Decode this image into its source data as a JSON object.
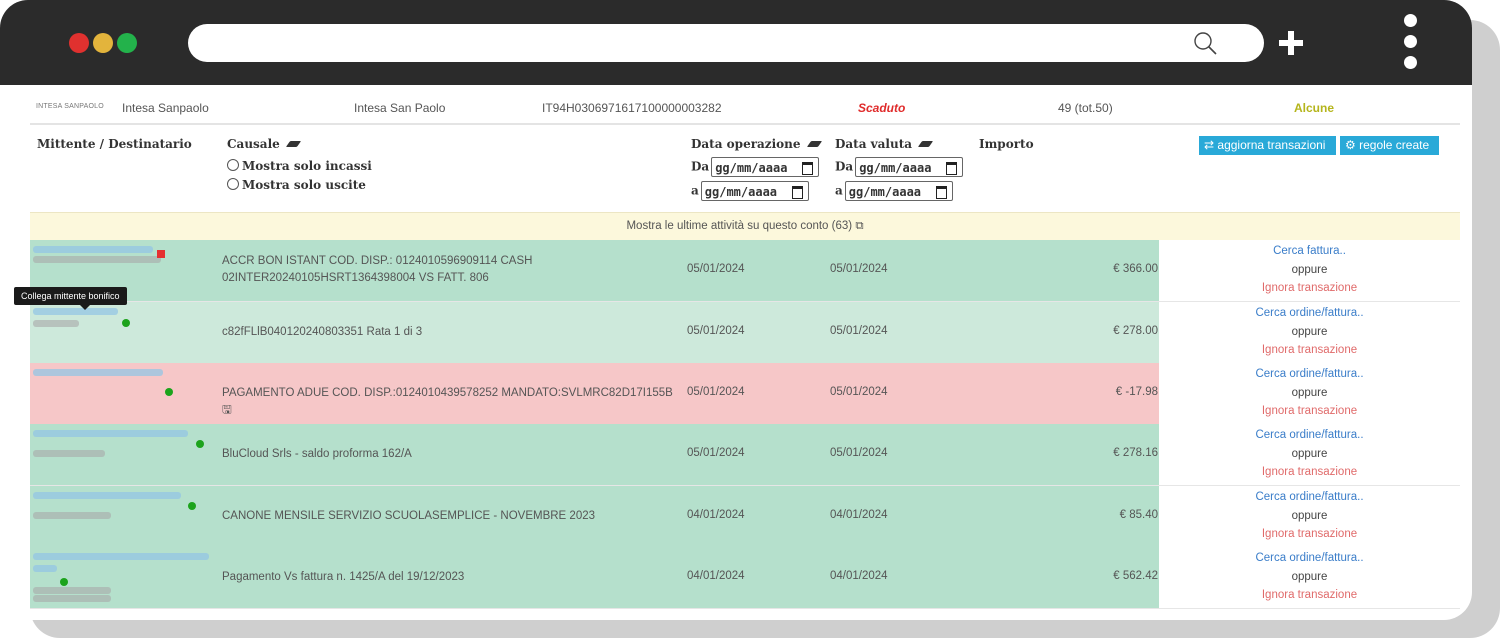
{
  "browser": {
    "dots": [
      "#e0312f",
      "#e3b43c",
      "#23b24b"
    ],
    "url": "",
    "icons": [
      "search-icon",
      "plus-icon",
      "more-vertical-icon"
    ]
  },
  "bank": {
    "logo_text": "INTESA SANPAOLO",
    "name": "Intesa Sanpaolo",
    "bank_label": "Intesa San Paolo",
    "iban": "IT94H0306971617100000003282",
    "status": "Scaduto",
    "count": "49 (tot.50)",
    "rules": "Alcune"
  },
  "filters": {
    "col_mittente": "Mittente / Destinatario",
    "col_causale": "Causale",
    "radio_incassi": "Mostra solo incassi",
    "radio_uscite": "Mostra solo uscite",
    "col_data_op": "Data operazione",
    "col_data_val": "Data valuta",
    "col_importo": "Importo",
    "da": "Da",
    "a": "a",
    "date_placeholder": "gg/mm/aaaa",
    "btn_aggiorna": "aggiorna transazioni",
    "btn_regole": "regole create"
  },
  "notice": "Mostra le ultime attività su questo conto (63)",
  "tooltip": "Collega mittente bonifico",
  "actions": {
    "cerca_fattura": "Cerca fattura..",
    "cerca_ordine": "Cerca ordine/fattura..",
    "oppure": "oppure",
    "ignora": "Ignora transazione"
  },
  "transactions": [
    {
      "causale": "ACCR BON ISTANT COD. DISP.: 0124010596909114 CASH 02INTER20240105HSRT1364398004 VS FATT. 806",
      "data_op": "05/01/2024",
      "data_val": "05/01/2024",
      "importo": "€ 366.00",
      "bg": "#b5e0cc"
    },
    {
      "causale": "c82fFLlB040120240803351 Rata 1 di 3",
      "data_op": "05/01/2024",
      "data_val": "05/01/2024",
      "importo": "€ 278.00",
      "bg": "#cde9db"
    },
    {
      "causale": "PAGAMENTO ADUE COD. DISP.:0124010439578252 MANDATO:SVLMRC82D17I155B",
      "data_op": "05/01/2024",
      "data_val": "05/01/2024",
      "importo": "€ -17.98",
      "bg": "#f6c7c8"
    },
    {
      "causale": "BluCloud Srls - saldo proforma 162/A",
      "data_op": "05/01/2024",
      "data_val": "05/01/2024",
      "importo": "€ 278.16",
      "bg": "#b5e0cc"
    },
    {
      "causale": "CANONE MENSILE SERVIZIO SCUOLASEMPLICE - NOVEMBRE 2023",
      "data_op": "04/01/2024",
      "data_val": "04/01/2024",
      "importo": "€ 85.40",
      "bg": "#b5e0cc"
    },
    {
      "causale": "Pagamento Vs fattura n. 1425/A del 19/12/2023",
      "data_op": "04/01/2024",
      "data_val": "04/01/2024",
      "importo": "€ 562.42",
      "bg": "#b5e0cc"
    }
  ],
  "colors": {
    "status_red": "#e02b2b",
    "rules_olive": "#b5b51c",
    "button_blue": "#29a9d8"
  }
}
